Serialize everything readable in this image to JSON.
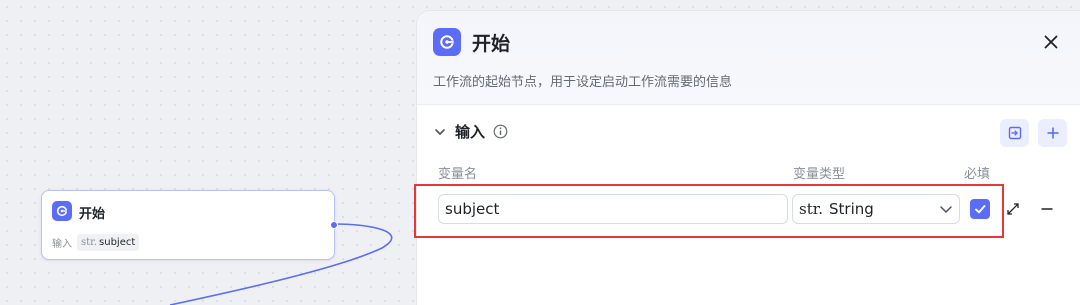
{
  "canvas": {
    "node": {
      "title": "开始",
      "input_label": "输入",
      "type_prefix": "str.",
      "variable": "subject"
    }
  },
  "panel": {
    "title": "开始",
    "description": "工作流的起始节点，用于设定启动工作流需要的信息",
    "section": {
      "title": "输入"
    },
    "columns": {
      "name": "变量名",
      "type": "变量类型",
      "required": "必填"
    },
    "row": {
      "name_value": "subject",
      "type_prefix": "str.",
      "type_value": "String",
      "required": true
    }
  },
  "colors": {
    "accent": "#5b6cf9",
    "highlight_border": "#e5383b"
  },
  "icons": {
    "node_icon": "start-node-icon",
    "close": "close-icon",
    "collapse": "chevron-down-icon",
    "info": "info-icon",
    "import": "import-icon",
    "add": "plus-icon",
    "checkbox": "check-icon",
    "expand": "expand-icon",
    "remove": "minus-icon"
  }
}
